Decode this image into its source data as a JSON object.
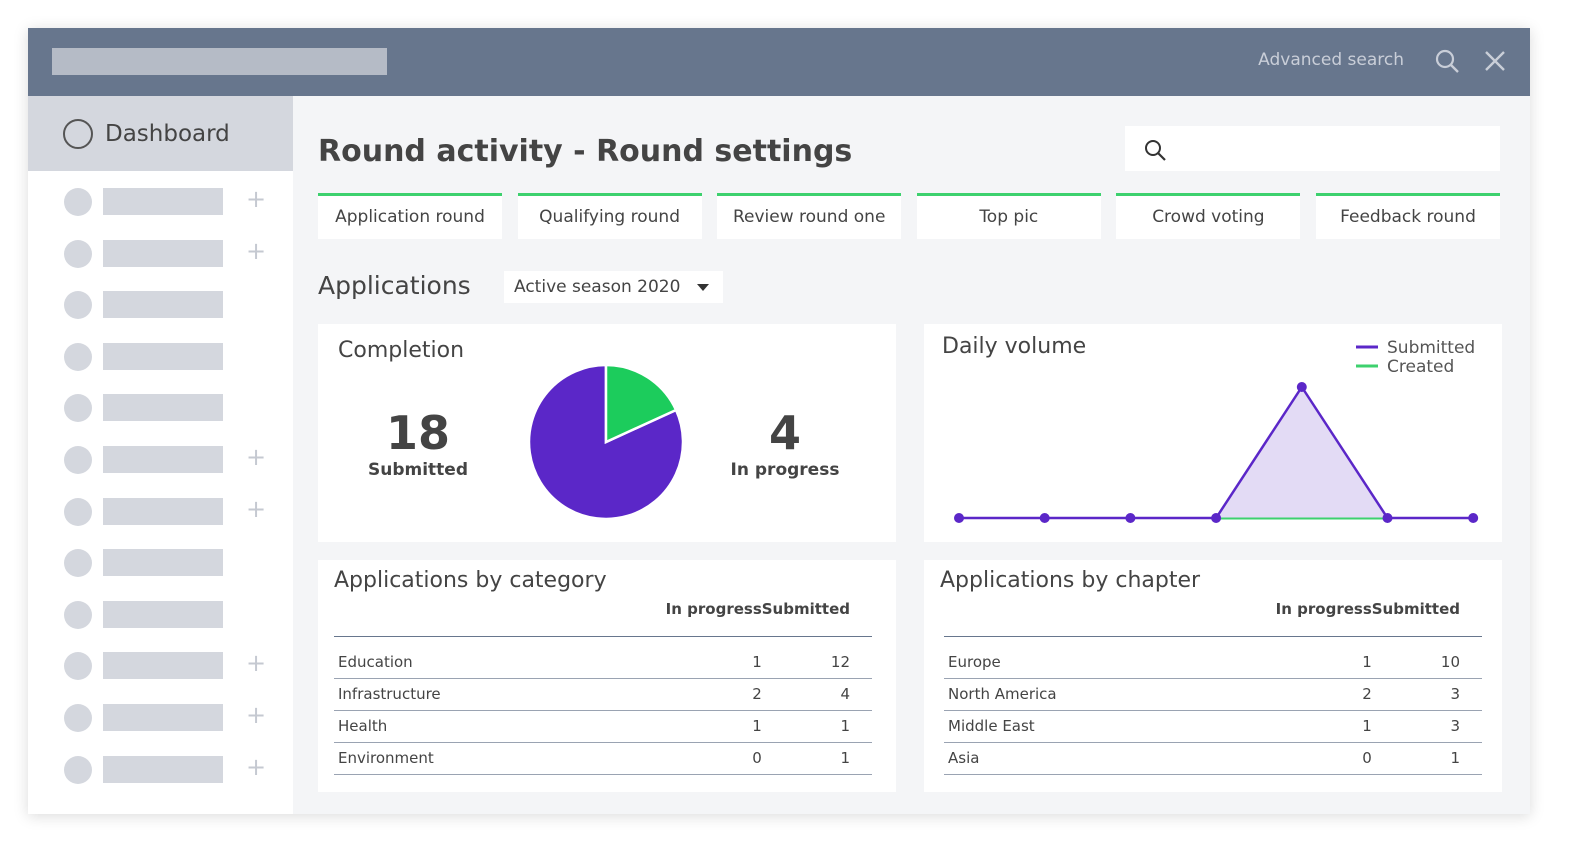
{
  "header": {
    "advanced_search": "Advanced search",
    "icons": [
      "search-icon",
      "close-icon"
    ]
  },
  "sidebar": {
    "dashboard": "Dashboard",
    "items_with_plus": [
      true,
      true,
      false,
      false,
      false,
      true,
      true,
      false,
      false,
      true,
      true,
      true
    ]
  },
  "page": {
    "title": "Round activity - Round settings",
    "search_placeholder": ""
  },
  "tabs": [
    "Application round",
    "Qualifying round",
    "Review round one",
    "Top pic",
    "Crowd voting",
    "Feedback round"
  ],
  "applications": {
    "label": "Applications",
    "season": "Active season 2020"
  },
  "completion": {
    "title": "Completion",
    "submitted": "18",
    "submitted_label": "Submitted",
    "in_progress": "4",
    "in_progress_label": "In progress",
    "colors": {
      "submitted": "#5b27c8",
      "in_progress": "#1ccc5c"
    }
  },
  "chart_data": {
    "type": "area",
    "title": "Daily volume",
    "x": [
      1,
      2,
      3,
      4,
      5,
      6,
      7
    ],
    "series": [
      {
        "name": "Submitted",
        "values": [
          0,
          0,
          0,
          0,
          1,
          0,
          0
        ],
        "color": "#5b27c8"
      },
      {
        "name": "Created",
        "values": [
          0,
          0,
          0,
          0,
          0,
          0,
          0
        ],
        "color": "#3dd16e"
      }
    ],
    "legend": "top-right",
    "grid": false
  },
  "by_category": {
    "title": "Applications by category",
    "headers": [
      "In progress",
      "Submitted"
    ],
    "rows": [
      [
        "Education",
        "1",
        "12"
      ],
      [
        "Infrastructure",
        "2",
        "4"
      ],
      [
        "Health",
        "1",
        "1"
      ],
      [
        "Environment",
        "0",
        "1"
      ]
    ]
  },
  "by_chapter": {
    "title": "Applications by chapter",
    "headers": [
      "In progress",
      "Submitted"
    ],
    "rows": [
      [
        "Europe",
        "1",
        "10"
      ],
      [
        "North America",
        "2",
        "3"
      ],
      [
        "Middle East",
        "1",
        "3"
      ],
      [
        "Asia",
        "0",
        "1"
      ]
    ]
  }
}
